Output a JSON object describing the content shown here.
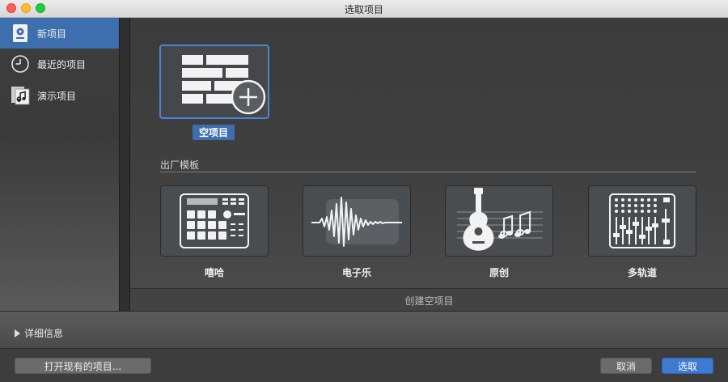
{
  "window": {
    "title": "选取项目"
  },
  "sidebar": {
    "items": [
      {
        "label": "新项目",
        "icon": "new-project-icon",
        "active": true
      },
      {
        "label": "最近的项目",
        "icon": "clock-icon",
        "active": false
      },
      {
        "label": "演示项目",
        "icon": "music-note-icon",
        "active": false
      }
    ]
  },
  "main": {
    "empty_project": {
      "label": "空项目",
      "icon": "empty-project-plus-icon"
    },
    "templates_section_title": "出厂模板",
    "templates": [
      {
        "label": "嘻哈",
        "icon": "drum-machine-icon"
      },
      {
        "label": "电子乐",
        "icon": "waveform-icon"
      },
      {
        "label": "原创",
        "icon": "guitar-icon"
      },
      {
        "label": "多轨道",
        "icon": "mixer-icon"
      }
    ],
    "create_bar_label": "创建空项目"
  },
  "details": {
    "label": "详细信息"
  },
  "footer": {
    "open_existing": "打开现有的项目...",
    "cancel": "取消",
    "choose": "选取"
  },
  "colors": {
    "accent": "#3d6fae",
    "button_primary": "#3d7ad0"
  }
}
